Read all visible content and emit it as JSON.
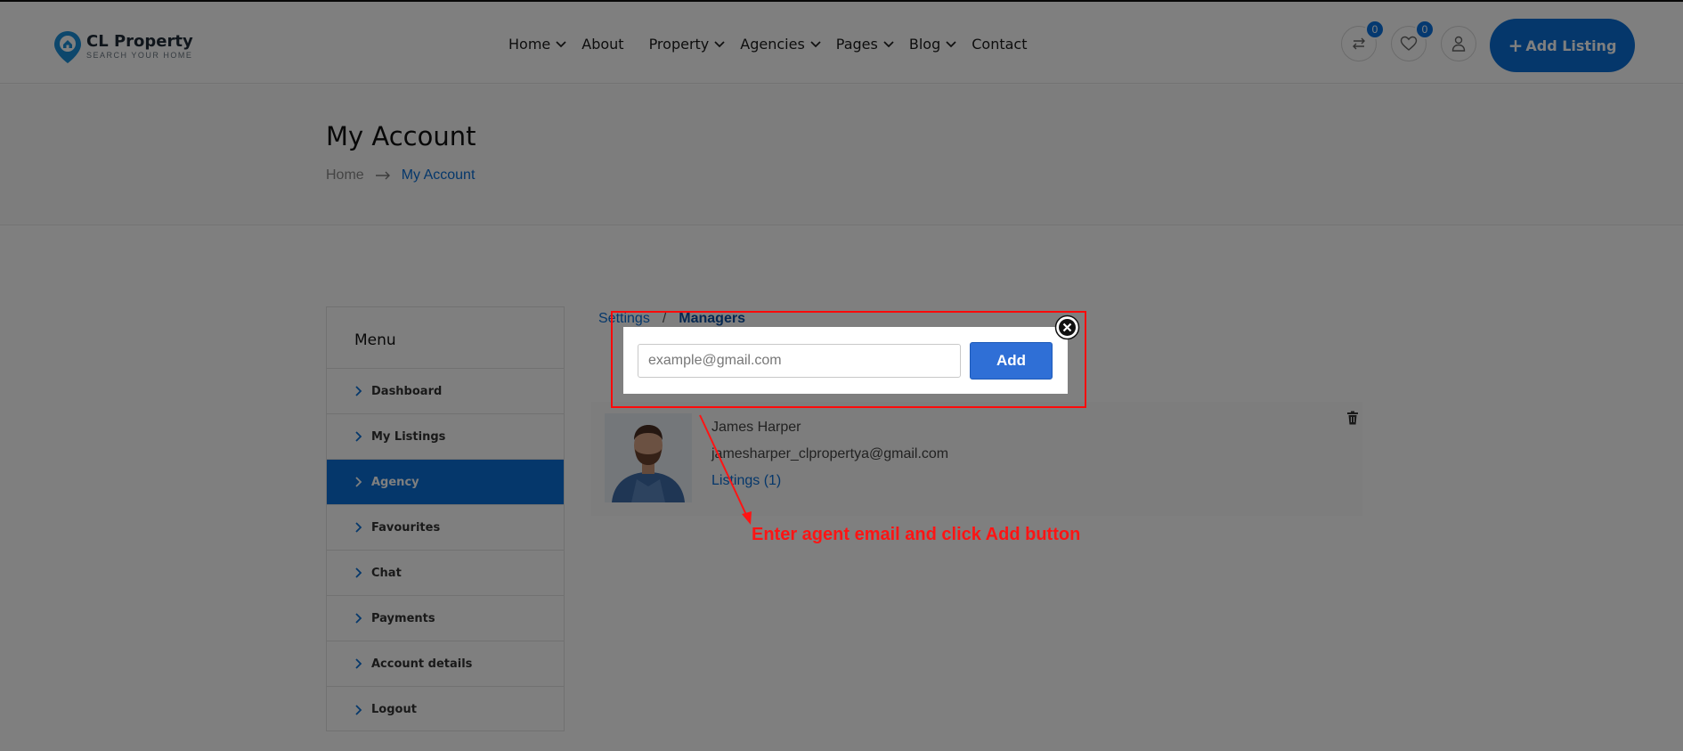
{
  "brand": {
    "name": "CL Property",
    "tagline": "SEARCH YOUR HOME",
    "accent": "#0a6fd6"
  },
  "nav": {
    "items": [
      {
        "label": "Home",
        "dropdown": true
      },
      {
        "label": "About",
        "dropdown": false
      },
      {
        "label": "Property",
        "dropdown": true
      },
      {
        "label": "Agencies",
        "dropdown": true
      },
      {
        "label": "Pages",
        "dropdown": true
      },
      {
        "label": "Blog",
        "dropdown": true
      },
      {
        "label": "Contact",
        "dropdown": false
      }
    ]
  },
  "header": {
    "compare_count": "0",
    "favorites_count": "0",
    "add_listing_label": "Add Listing",
    "add_listing_icon": "plus-icon"
  },
  "page": {
    "title": "My Account",
    "breadcrumb": {
      "home": "Home",
      "current": "My Account"
    }
  },
  "sidebar": {
    "title": "Menu",
    "items": [
      {
        "label": "Dashboard",
        "active": false
      },
      {
        "label": "My Listings",
        "active": false
      },
      {
        "label": "Agency",
        "active": true
      },
      {
        "label": "Favourites",
        "active": false
      },
      {
        "label": "Chat",
        "active": false
      },
      {
        "label": "Payments",
        "active": false
      },
      {
        "label": "Account details",
        "active": false
      },
      {
        "label": "Logout",
        "active": false
      }
    ]
  },
  "content": {
    "tabs": {
      "settings": "Settings",
      "separator": "/",
      "managers": "Managers"
    },
    "agent": {
      "name": "James Harper",
      "email": "jamesharper_clpropertya@gmail.com",
      "listings": "Listings (1)"
    }
  },
  "modal": {
    "input_placeholder": "example@gmail.com",
    "input_value": "",
    "add_label": "Add"
  },
  "annotation": {
    "text": "Enter agent email and click Add button",
    "color": "#ff1414"
  }
}
